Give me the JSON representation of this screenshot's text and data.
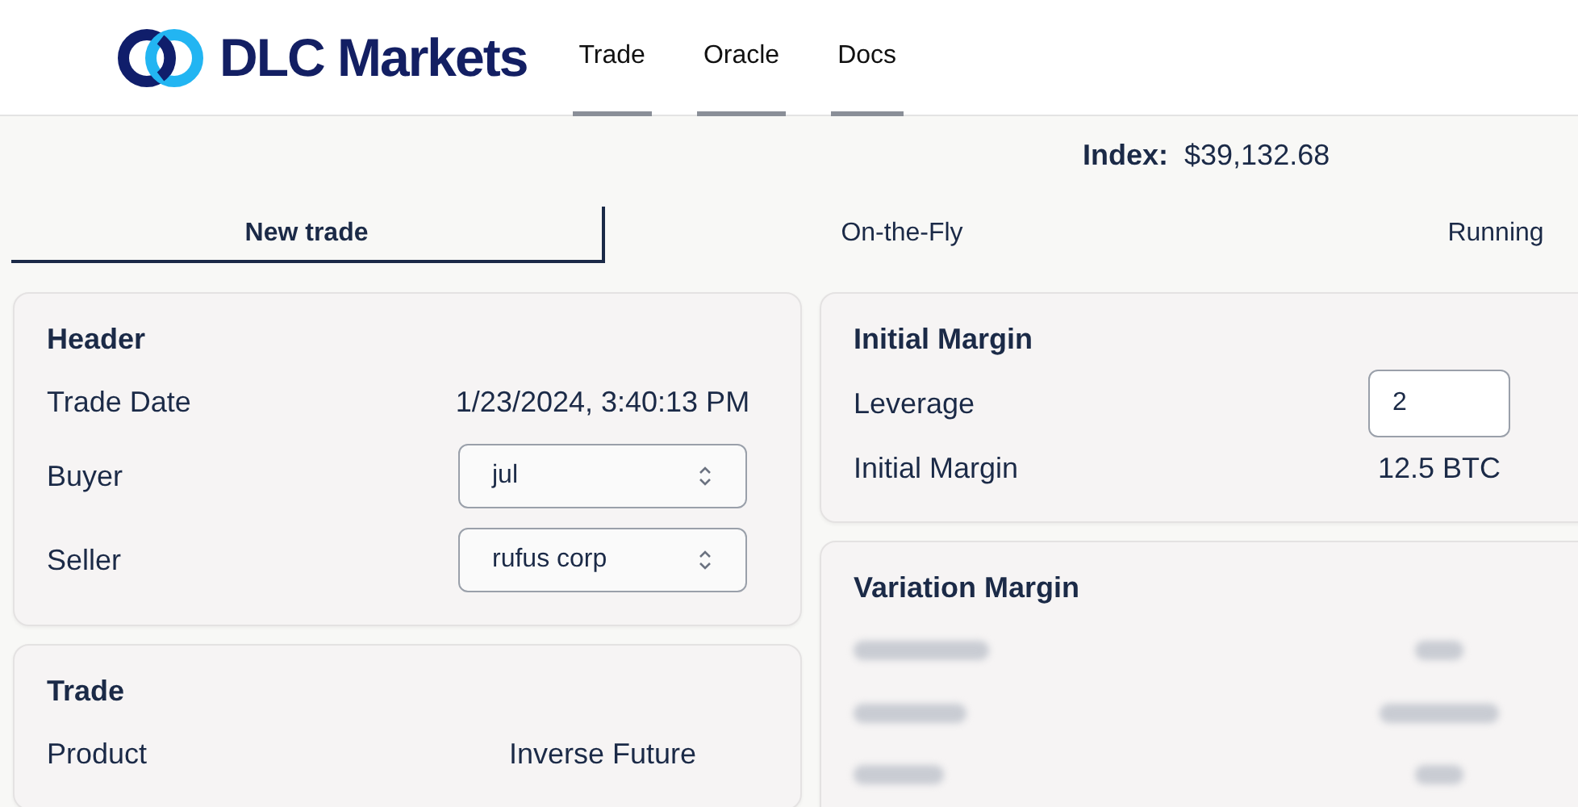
{
  "brand": {
    "name": "DLC Markets"
  },
  "nav": [
    {
      "label": "Trade",
      "selected": false
    },
    {
      "label": "Oracle",
      "selected": false
    },
    {
      "label": "Docs",
      "selected": false
    }
  ],
  "index": {
    "label": "Index:",
    "value": "$39,132.68"
  },
  "tabs": [
    {
      "label": "New trade",
      "selected": true
    },
    {
      "label": "On-the-Fly",
      "selected": false
    },
    {
      "label": "Running",
      "selected": false
    }
  ],
  "left_cards": [
    {
      "title": "Header",
      "rows": [
        {
          "kind": "text",
          "label": "Trade Date",
          "value": "1/23/2024, 3:40:13 PM"
        },
        {
          "kind": "select",
          "label": "Buyer",
          "value": "jul"
        },
        {
          "kind": "select",
          "label": "Seller",
          "value": "rufus corp"
        }
      ]
    },
    {
      "title": "Trade",
      "rows": [
        {
          "kind": "text",
          "label": "Product",
          "value": "Inverse Future"
        }
      ]
    }
  ],
  "right_cards": [
    {
      "title": "Initial Margin",
      "rows": [
        {
          "kind": "input",
          "label": "Leverage",
          "value": "2"
        },
        {
          "kind": "text",
          "label": "Initial Margin",
          "value": "12.5 BTC"
        }
      ]
    },
    {
      "title": "Variation Margin",
      "rows": [
        {
          "kind": "blurred"
        },
        {
          "kind": "blurred"
        },
        {
          "kind": "blurred"
        }
      ]
    }
  ]
}
